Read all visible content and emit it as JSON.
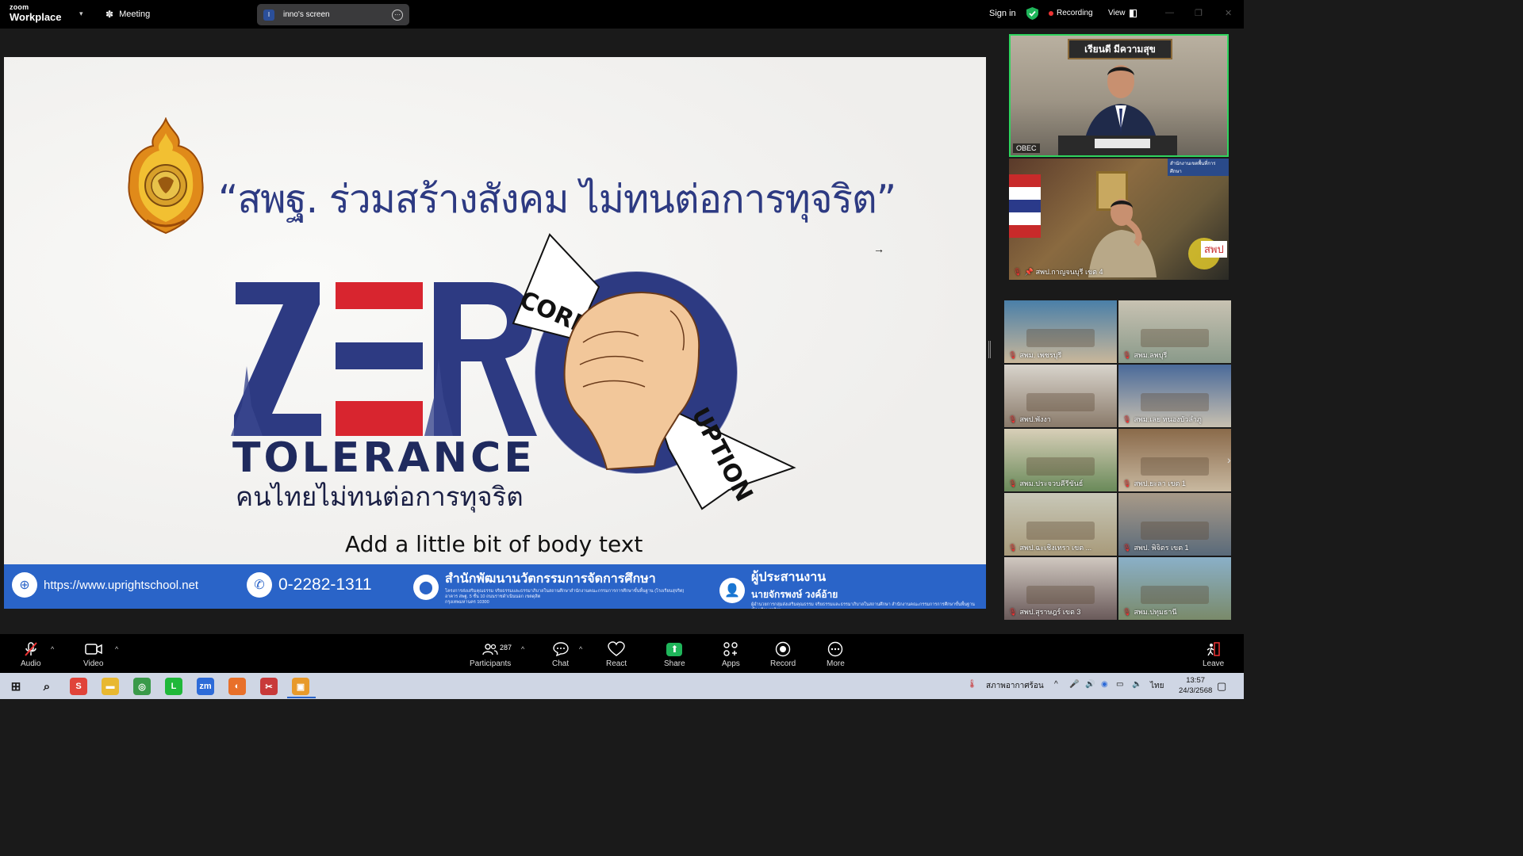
{
  "topbar": {
    "logo_line1": "zoom",
    "logo_line2": "Workplace",
    "meeting_label": "Meeting",
    "screen_badge": "I",
    "screen_label": "inno's screen",
    "signin_label": "Sign in",
    "recording_label": "Recording",
    "view_label": "View"
  },
  "slide": {
    "slogan": "“สพฐ. ร่วมสร้างสังคม ไม่ทนต่อการทุจริต”",
    "zero_letters": [
      "Z",
      "E",
      "R",
      "O"
    ],
    "corruption_left": "CORR",
    "corruption_right": "UPTION",
    "tolerance": "TOLERANCE",
    "thai_subtitle": "คนไทยไม่ทนต่อการทุจริต",
    "body_text": "Add a little bit of body text",
    "footer": {
      "website": "https://www.uprightschool.net",
      "phone": "0-2282-1311",
      "org_title": "สำนักพัฒนานวัตกรรมการจัดการศึกษา",
      "org_detail_1": "โครงการส่งเสริมคุณธรรม จริยธรรมและธรรมาภิบาลในสถานศึกษาสำนักงานคณะกรรมการการศึกษาขั้นพื้นฐาน (โรงเรียนสุจริต)",
      "org_detail_2": "อาคาร สพฐ. 5 ชั้น 10 ถนนราชดำเนินนอก เขตดุสิต",
      "org_detail_3": "กรุงเทพมหานคร 10300",
      "coord_title": "ผู้ประสานงาน",
      "coord_name": "นายจักรพงษ์ วงค์อ้าย",
      "coord_detail": "ผู้อำนวยการกลุ่มส่งเสริมคุณธรรม จริยธรรมและธรรมาภิบาลในสถานศึกษา สำนักงานคณะกรรมการการศึกษาขั้นพื้นฐาน (โรงเรียนสุจริต)"
    }
  },
  "videos": {
    "speaker_banner": "เรียนดี มีความสุข",
    "speaker_name": "OBEC",
    "second_name": "สพป.กาญจนบุรี เขต 4",
    "second_sign": "สพป",
    "second_banner": "สำนักงานเขตพื้นที่การศึกษา",
    "gallery": [
      {
        "name": "สพม. เพชรบุรี",
        "c1": "#4a7fa8",
        "c2": "#c9b79a"
      },
      {
        "name": "สพม.ลพบุรี",
        "c1": "#c8c2b2",
        "c2": "#8a9a8a"
      },
      {
        "name": "สพป.พังงา",
        "c1": "#d8d4cc",
        "c2": "#8a7a6a"
      },
      {
        "name": "สพม.เลย หนองบัวลำภู",
        "c1": "#4a6a9a",
        "c2": "#c8c0b0"
      },
      {
        "name": "สพม.ประจวบคีรีขันธ์",
        "c1": "#d8cfb8",
        "c2": "#6a8a5a"
      },
      {
        "name": "สพป.ยะลา เขต 1",
        "c1": "#8a6a4a",
        "c2": "#c8b8a0"
      },
      {
        "name": "สพป.ฉะเชิงเทรา เขต ...",
        "c1": "#c8c8b8",
        "c2": "#a89a7a"
      },
      {
        "name": "สพป. พิจิตร เขต 1",
        "c1": "#a89a88",
        "c2": "#5a6a7a"
      },
      {
        "name": "สพป.สุราษฎร์ เขต 3",
        "c1": "#d0c8c0",
        "c2": "#6a5a5a"
      },
      {
        "name": "สพม.ปทุมธานี",
        "c1": "#8ab0c8",
        "c2": "#7a8a6a"
      }
    ]
  },
  "toolbar": {
    "audio": "Audio",
    "video": "Video",
    "participants": "Participants",
    "participant_count": "287",
    "chat": "Chat",
    "react": "React",
    "share": "Share",
    "apps": "Apps",
    "record": "Record",
    "more": "More",
    "leave": "Leave"
  },
  "taskbar": {
    "weather": "สภาพอากาศร้อน",
    "lang": "ไทย",
    "time": "13:57",
    "date": "24/3/2568",
    "apps": [
      {
        "name": "search-icon",
        "color": "transparent"
      },
      {
        "name": "smartsheet-icon",
        "color": "#e0443a"
      },
      {
        "name": "file-explorer-icon",
        "color": "#e8b830"
      },
      {
        "name": "chrome-icon",
        "color": "#3a9a4a"
      },
      {
        "name": "line-icon",
        "color": "#1fb83a"
      },
      {
        "name": "zoom-icon",
        "color": "#2d6bd8"
      },
      {
        "name": "firefox-icon",
        "color": "#e8702a"
      },
      {
        "name": "snip-icon",
        "color": "#c83a3a"
      },
      {
        "name": "presentation-icon",
        "color": "#e89a2a"
      }
    ]
  },
  "colors": {
    "speaker_border": "#2fd45e",
    "footer_blue": "#2a64c8",
    "navy": "#2d3a82",
    "flag_red": "#d8252f",
    "share_green": "#1fb55a"
  }
}
